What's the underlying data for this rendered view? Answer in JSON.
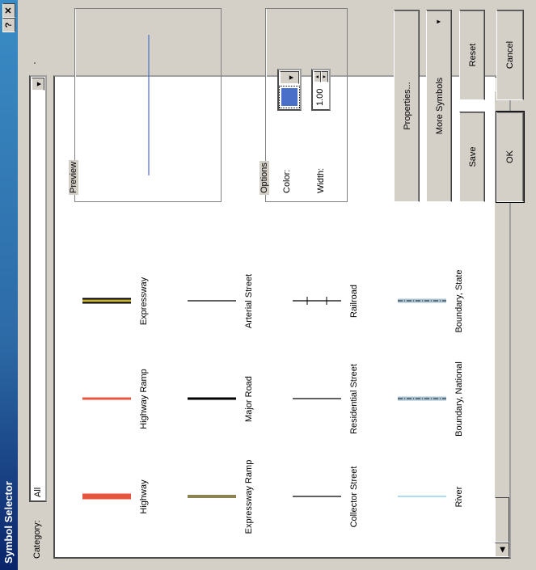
{
  "dialog": {
    "title": "Symbol Selector",
    "help_label": "?",
    "close_label": "✕"
  },
  "category": {
    "label": "Category:",
    "value": "All"
  },
  "symbols": [
    {
      "label": "Highway",
      "color": "#e8553c",
      "style": "thick"
    },
    {
      "label": "Highway Ramp",
      "color": "#e8553c",
      "style": "medium"
    },
    {
      "label": "Expressway",
      "color": "#c8b432",
      "style": "cased"
    },
    {
      "label": "",
      "style": "blank"
    },
    {
      "label": "Expressway Ramp",
      "color": "#c8b432",
      "style": "thin-cased"
    },
    {
      "label": "Major Road",
      "color": "#000000",
      "style": "medium"
    },
    {
      "label": "Arterial Street",
      "color": "#000000",
      "style": "thin"
    },
    {
      "label": "",
      "style": "blank"
    },
    {
      "label": "Collector Street",
      "color": "#000000",
      "style": "thin"
    },
    {
      "label": "Residential Street",
      "color": "#000000",
      "style": "thin"
    },
    {
      "label": "Railroad",
      "color": "#000000",
      "style": "railroad"
    },
    {
      "label": "",
      "style": "blank"
    },
    {
      "label": "River",
      "color": "#7ec8e3",
      "style": "thin"
    },
    {
      "label": "Boundary, National",
      "color": "#a8c0d0",
      "style": "boundary"
    },
    {
      "label": "Boundary, State",
      "color": "#a8c0d0",
      "style": "boundary"
    },
    {
      "label": "",
      "style": "blank"
    }
  ],
  "preview": {
    "legend": "Preview",
    "line_color": "#4a6fc9"
  },
  "options": {
    "legend": "Options",
    "color_label": "Color:",
    "width_label": "Width:",
    "width_value": "1.00",
    "swatch_color": "#4a6fc9"
  },
  "buttons": {
    "properties": "Properties...",
    "more_symbols": "More Symbols",
    "save": "Save",
    "reset": "Reset",
    "ok": "OK",
    "cancel": "Cancel"
  }
}
